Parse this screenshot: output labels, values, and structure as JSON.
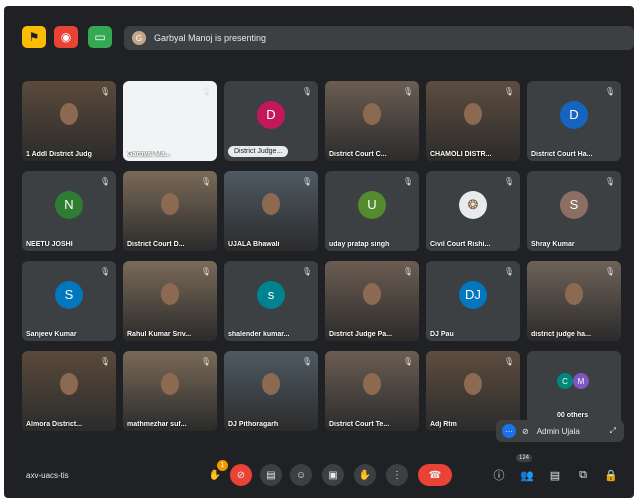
{
  "presenting_text": "Garbyal Manoj is presenting",
  "meeting_code": "axv-uacs-tis",
  "participants_count": "124",
  "hand_badge": "1",
  "admin_label": "Admin Ujala",
  "colors": {
    "bg": "#202124",
    "tile": "#3c4043",
    "end_call": "#ea4335"
  },
  "tiles": [
    {
      "label": "1 Addl District Judg",
      "type": "video"
    },
    {
      "label": "Garbyal Ma...",
      "type": "screen"
    },
    {
      "label": "District Judge...",
      "type": "avatar",
      "initial": "D",
      "color": "#c2185b"
    },
    {
      "label": "District Court C...",
      "type": "video"
    },
    {
      "label": "CHAMOLI DISTR...",
      "type": "video"
    },
    {
      "label": "District Court Ha...",
      "type": "avatar",
      "initial": "D",
      "color": "#1565c0"
    },
    {
      "label": "NEETU JOSHI",
      "type": "avatar",
      "initial": "N",
      "color": "#2e7d32"
    },
    {
      "label": "District Court D...",
      "type": "video"
    },
    {
      "label": "UJALA Bhawali",
      "type": "video"
    },
    {
      "label": "uday pratap singh",
      "type": "avatar",
      "initial": "U",
      "color": "#558b2f"
    },
    {
      "label": "Civil Court Rishi...",
      "type": "emblem"
    },
    {
      "label": "Shray Kumar",
      "type": "avatar",
      "initial": "S",
      "color": "#8d6e63"
    },
    {
      "label": "Sanjeev Kumar",
      "type": "avatar",
      "initial": "S",
      "color": "#0277bd"
    },
    {
      "label": "Rahul Kumar Sriv...",
      "type": "video"
    },
    {
      "label": "shalender kumar...",
      "type": "avatar",
      "initial": "s",
      "color": "#00838f"
    },
    {
      "label": "District Judge Pa...",
      "type": "video"
    },
    {
      "label": "DJ Pau",
      "type": "avatar",
      "initial": "DJ",
      "color": "#0277bd"
    },
    {
      "label": "district judge ha...",
      "type": "video"
    },
    {
      "label": "Almora District...",
      "type": "video"
    },
    {
      "label": "mathmezhar suf...",
      "type": "video"
    },
    {
      "label": "DJ Pithoragarh",
      "type": "video"
    },
    {
      "label": "District Court Te...",
      "type": "video"
    },
    {
      "label": "Adj Rtm",
      "type": "video"
    },
    {
      "label": "00 others",
      "type": "others"
    }
  ]
}
